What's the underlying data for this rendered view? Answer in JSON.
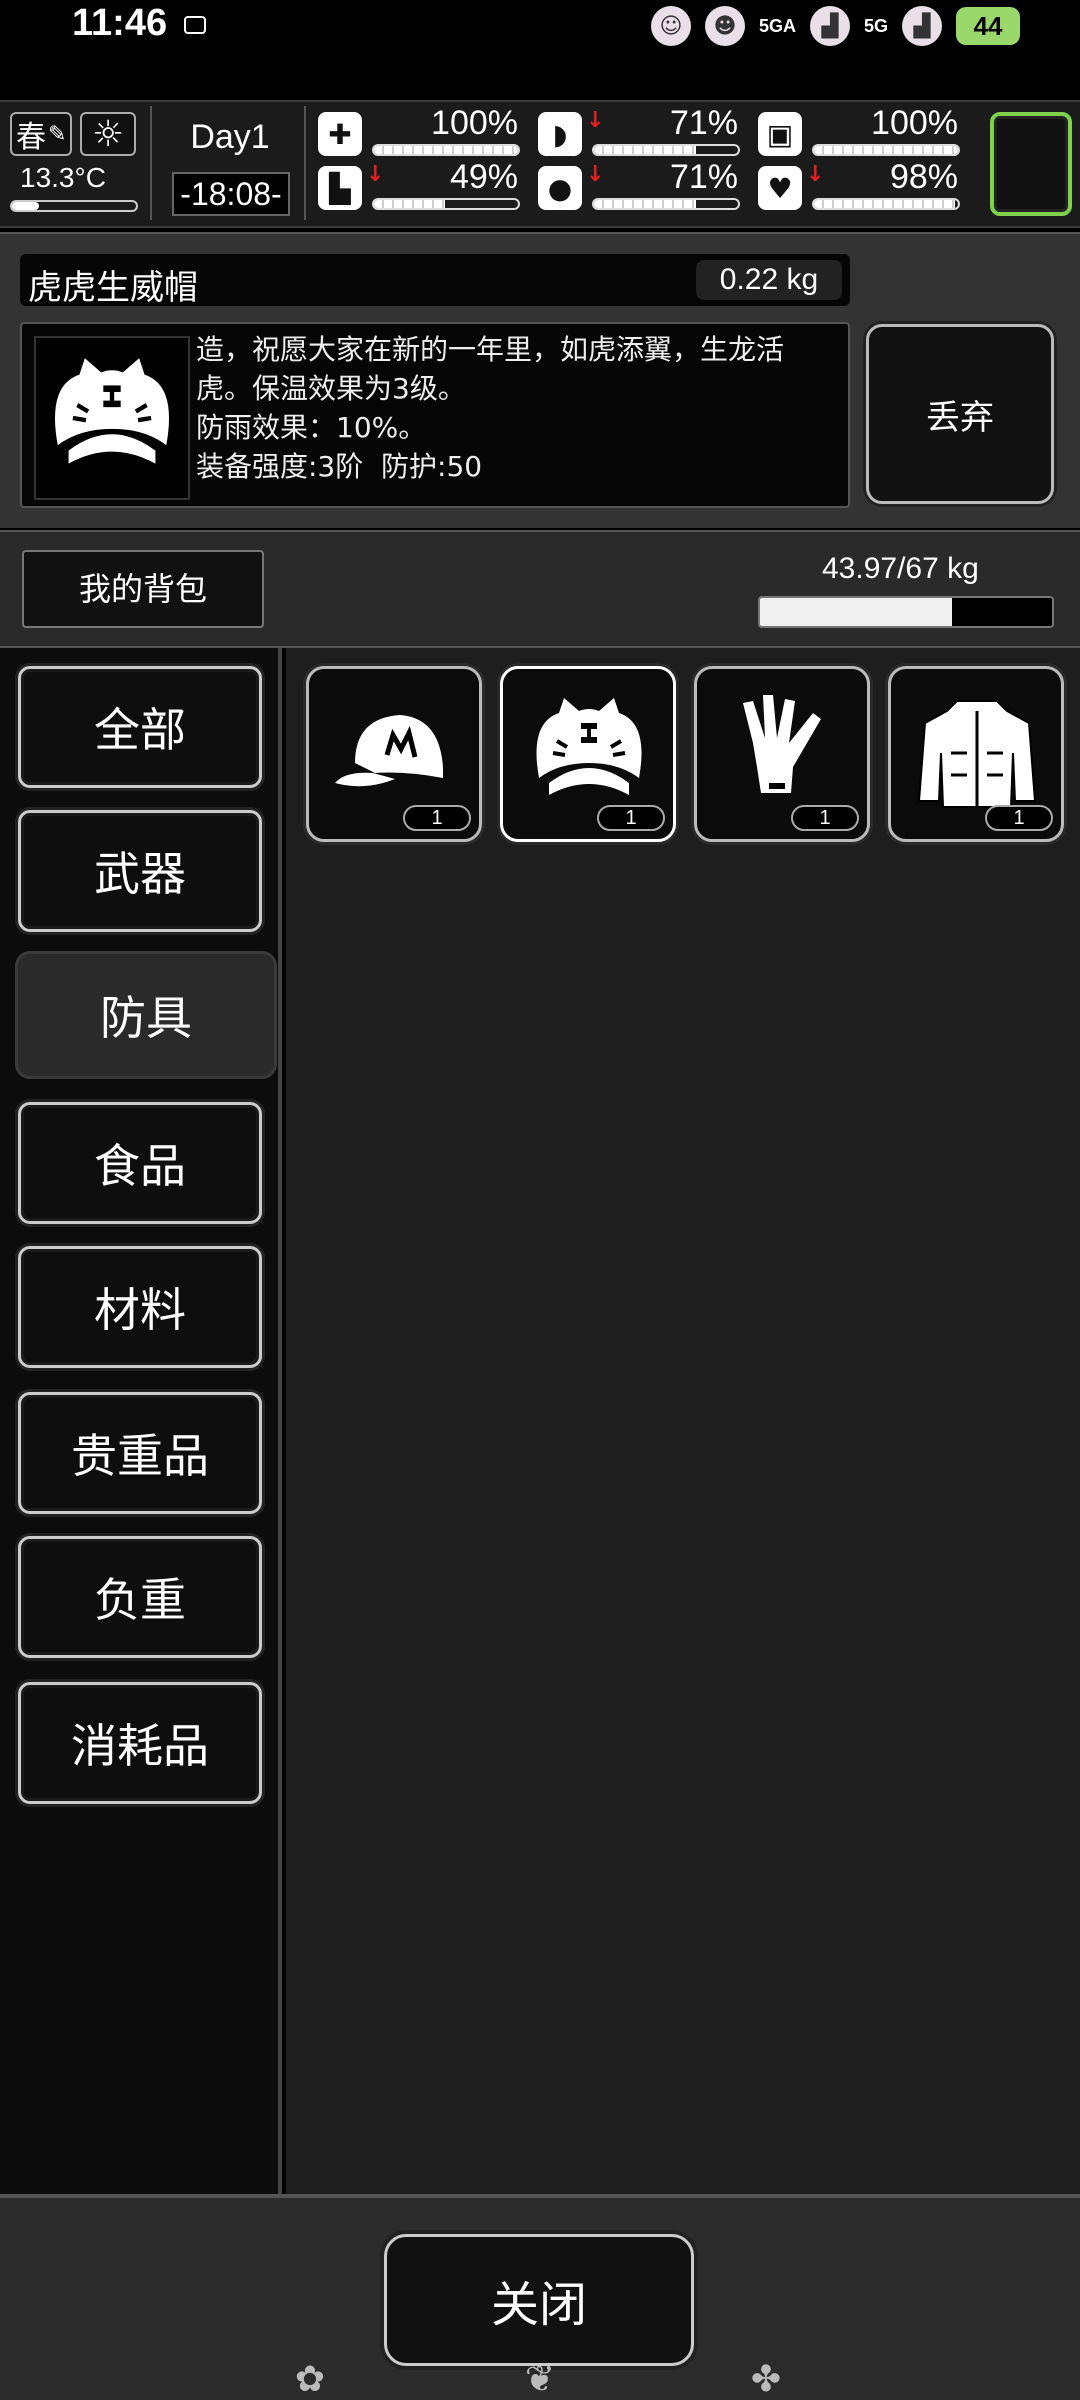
{
  "status_bar": {
    "time": "11:46",
    "network_a": "5GA",
    "network_b": "5G",
    "battery": "44"
  },
  "hud": {
    "season": "春",
    "temperature": "13.3°C",
    "day": "Day1",
    "clock": "-18:08-",
    "stats": [
      {
        "icon": "medkit-icon",
        "value": "100%",
        "level": 1.0,
        "falling": false
      },
      {
        "icon": "stomach-icon",
        "value": "71%",
        "level": 0.71,
        "falling": true
      },
      {
        "icon": "canister-icon",
        "value": "100%",
        "level": 1.0,
        "falling": false
      },
      {
        "icon": "boot-icon",
        "value": "49%",
        "level": 0.49,
        "falling": true
      },
      {
        "icon": "water-drop-icon",
        "value": "71%",
        "level": 0.71,
        "falling": true
      },
      {
        "icon": "heart-icon",
        "value": "98%",
        "level": 0.98,
        "falling": true
      }
    ],
    "accent_color": "#7fd04a",
    "warning_color": "#e02020"
  },
  "item": {
    "name": "虎虎生威帽",
    "weight": "0.22 kg",
    "description": [
      "造，祝愿大家在新的一年里，如虎添翼，生龙活",
      "虎。保温效果为3级。",
      "防雨效果：10%。",
      "装备强度:3阶  防护:50"
    ],
    "discard_label": "丢弃"
  },
  "bag": {
    "title": "我的背包",
    "weight": "43.97/67 kg",
    "fill": 0.656
  },
  "categories": [
    {
      "label": "全部",
      "active": false
    },
    {
      "label": "武器",
      "active": false
    },
    {
      "label": "防具",
      "active": true
    },
    {
      "label": "食品",
      "active": false
    },
    {
      "label": "材料",
      "active": false
    },
    {
      "label": "贵重品",
      "active": false
    },
    {
      "label": "负重",
      "active": false
    },
    {
      "label": "消耗品",
      "active": false
    }
  ],
  "inventory": [
    {
      "icon": "baseball-cap-icon",
      "count": "1",
      "selected": false
    },
    {
      "icon": "tiger-hat-icon",
      "count": "1",
      "selected": true
    },
    {
      "icon": "glove-icon",
      "count": "1",
      "selected": false
    },
    {
      "icon": "jacket-icon",
      "count": "1",
      "selected": false
    }
  ],
  "footer": {
    "close_label": "关闭"
  }
}
